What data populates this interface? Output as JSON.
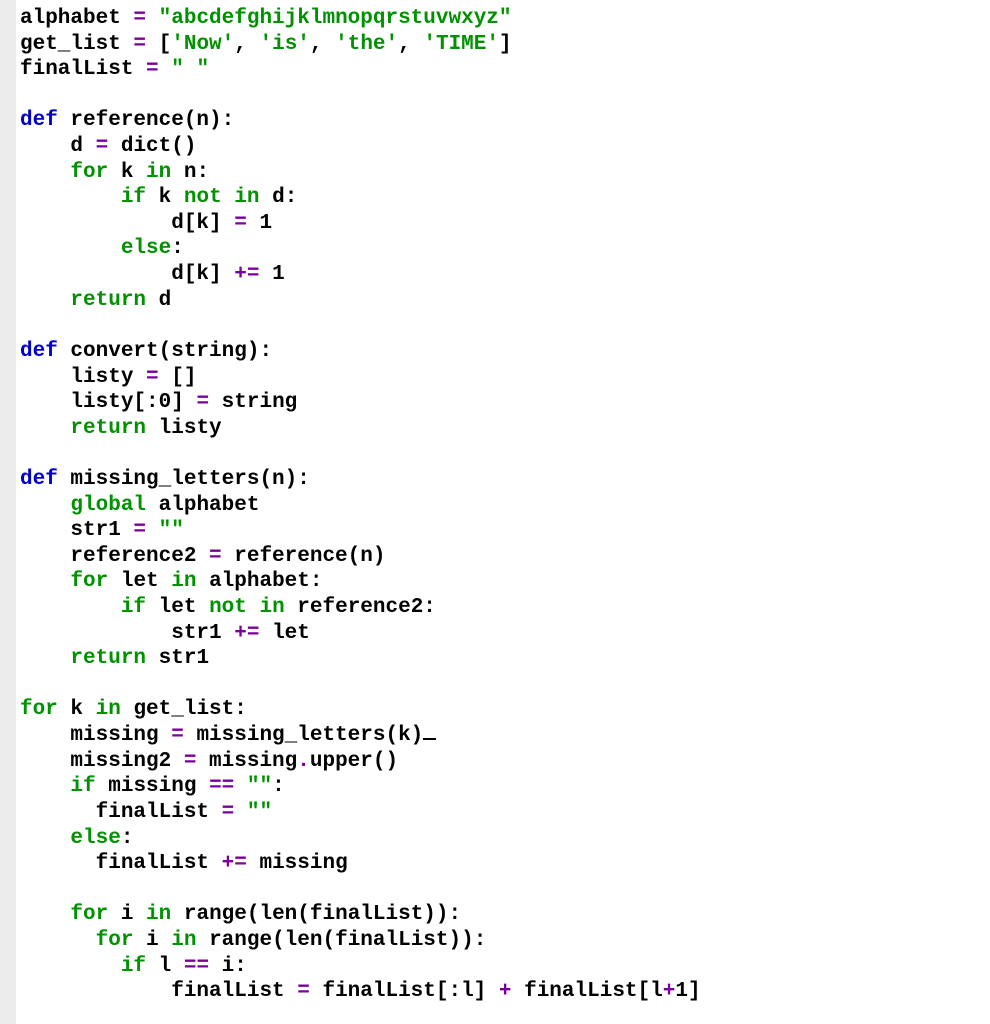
{
  "code": {
    "tokens": [
      [
        [
          "plain",
          "alphabet "
        ],
        [
          "op",
          "="
        ],
        [
          "plain",
          " "
        ],
        [
          "str",
          "\"abcdefghijklmnopqrstuvwxyz\""
        ]
      ],
      [
        [
          "plain",
          "get_list "
        ],
        [
          "op",
          "="
        ],
        [
          "plain",
          " ["
        ],
        [
          "str",
          "'Now'"
        ],
        [
          "plain",
          ", "
        ],
        [
          "str",
          "'is'"
        ],
        [
          "plain",
          ", "
        ],
        [
          "str",
          "'the'"
        ],
        [
          "plain",
          ", "
        ],
        [
          "str",
          "'TIME'"
        ],
        [
          "plain",
          "]"
        ]
      ],
      [
        [
          "plain",
          "finalList "
        ],
        [
          "op",
          "="
        ],
        [
          "plain",
          " "
        ],
        [
          "str",
          "\" \""
        ]
      ],
      [],
      [
        [
          "def",
          "def"
        ],
        [
          "plain",
          " reference(n):"
        ]
      ],
      [
        [
          "plain",
          "    d "
        ],
        [
          "op",
          "="
        ],
        [
          "plain",
          " dict()"
        ]
      ],
      [
        [
          "plain",
          "    "
        ],
        [
          "kw",
          "for"
        ],
        [
          "plain",
          " k "
        ],
        [
          "kw",
          "in"
        ],
        [
          "plain",
          " n:"
        ]
      ],
      [
        [
          "plain",
          "        "
        ],
        [
          "kw",
          "if"
        ],
        [
          "plain",
          " k "
        ],
        [
          "kw",
          "not in"
        ],
        [
          "plain",
          " d:"
        ]
      ],
      [
        [
          "plain",
          "            d[k] "
        ],
        [
          "op",
          "="
        ],
        [
          "plain",
          " "
        ],
        [
          "plain",
          "1"
        ]
      ],
      [
        [
          "plain",
          "        "
        ],
        [
          "kw",
          "else"
        ],
        [
          "plain",
          ":"
        ]
      ],
      [
        [
          "plain",
          "            d[k] "
        ],
        [
          "op",
          "+="
        ],
        [
          "plain",
          " "
        ],
        [
          "plain",
          "1"
        ]
      ],
      [
        [
          "plain",
          "    "
        ],
        [
          "kw",
          "return"
        ],
        [
          "plain",
          " d"
        ]
      ],
      [],
      [
        [
          "def",
          "def"
        ],
        [
          "plain",
          " convert(string):"
        ]
      ],
      [
        [
          "plain",
          "    listy "
        ],
        [
          "op",
          "="
        ],
        [
          "plain",
          " []"
        ]
      ],
      [
        [
          "plain",
          "    listy[:"
        ],
        [
          "plain",
          "0"
        ],
        [
          "plain",
          "] "
        ],
        [
          "op",
          "="
        ],
        [
          "plain",
          " string"
        ]
      ],
      [
        [
          "plain",
          "    "
        ],
        [
          "kw",
          "return"
        ],
        [
          "plain",
          " listy"
        ]
      ],
      [],
      [
        [
          "def",
          "def"
        ],
        [
          "plain",
          " missing_letters(n):"
        ]
      ],
      [
        [
          "plain",
          "    "
        ],
        [
          "kw",
          "global"
        ],
        [
          "plain",
          " alphabet"
        ]
      ],
      [
        [
          "plain",
          "    str1 "
        ],
        [
          "op",
          "="
        ],
        [
          "plain",
          " "
        ],
        [
          "str",
          "\"\""
        ]
      ],
      [
        [
          "plain",
          "    reference2 "
        ],
        [
          "op",
          "="
        ],
        [
          "plain",
          " reference(n)"
        ]
      ],
      [
        [
          "plain",
          "    "
        ],
        [
          "kw",
          "for"
        ],
        [
          "plain",
          " let "
        ],
        [
          "kw",
          "in"
        ],
        [
          "plain",
          " alphabet:"
        ]
      ],
      [
        [
          "plain",
          "        "
        ],
        [
          "kw",
          "if"
        ],
        [
          "plain",
          " let "
        ],
        [
          "kw",
          "not in"
        ],
        [
          "plain",
          " reference2:"
        ]
      ],
      [
        [
          "plain",
          "            str1 "
        ],
        [
          "op",
          "+="
        ],
        [
          "plain",
          " let"
        ]
      ],
      [
        [
          "plain",
          "    "
        ],
        [
          "kw",
          "return"
        ],
        [
          "plain",
          " str1"
        ]
      ],
      [],
      [
        [
          "kw",
          "for"
        ],
        [
          "plain",
          " k "
        ],
        [
          "kw",
          "in"
        ],
        [
          "plain",
          " get_list:"
        ]
      ],
      [
        [
          "plain",
          "    missing "
        ],
        [
          "op",
          "="
        ],
        [
          "plain",
          " missing_letters(k)"
        ],
        [
          "cursor",
          ""
        ]
      ],
      [
        [
          "plain",
          "    missing2 "
        ],
        [
          "op",
          "="
        ],
        [
          "plain",
          " missing"
        ],
        [
          "op",
          "."
        ],
        [
          "plain",
          "upper()"
        ]
      ],
      [
        [
          "plain",
          "    "
        ],
        [
          "kw",
          "if"
        ],
        [
          "plain",
          " missing "
        ],
        [
          "op",
          "=="
        ],
        [
          "plain",
          " "
        ],
        [
          "str",
          "\"\""
        ],
        [
          "plain",
          ":"
        ]
      ],
      [
        [
          "plain",
          "      finalList "
        ],
        [
          "op",
          "="
        ],
        [
          "plain",
          " "
        ],
        [
          "str",
          "\"\""
        ]
      ],
      [
        [
          "plain",
          "    "
        ],
        [
          "kw",
          "else"
        ],
        [
          "plain",
          ":"
        ]
      ],
      [
        [
          "plain",
          "      finalList "
        ],
        [
          "op",
          "+="
        ],
        [
          "plain",
          " missing"
        ]
      ],
      [],
      [
        [
          "plain",
          "    "
        ],
        [
          "kw",
          "for"
        ],
        [
          "plain",
          " i "
        ],
        [
          "kw",
          "in"
        ],
        [
          "plain",
          " range(len(finalList)):"
        ]
      ],
      [
        [
          "plain",
          "      "
        ],
        [
          "kw",
          "for"
        ],
        [
          "plain",
          " i "
        ],
        [
          "kw",
          "in"
        ],
        [
          "plain",
          " range(len(finalList)):"
        ]
      ],
      [
        [
          "plain",
          "        "
        ],
        [
          "kw",
          "if"
        ],
        [
          "plain",
          " l "
        ],
        [
          "op",
          "=="
        ],
        [
          "plain",
          " i:"
        ]
      ],
      [
        [
          "plain",
          "            finalList "
        ],
        [
          "op",
          "="
        ],
        [
          "plain",
          " finalList[:l] "
        ],
        [
          "op",
          "+"
        ],
        [
          "plain",
          " finalList[l"
        ],
        [
          "op",
          "+"
        ],
        [
          "plain",
          "1"
        ],
        [
          "plain",
          "]"
        ]
      ]
    ]
  }
}
